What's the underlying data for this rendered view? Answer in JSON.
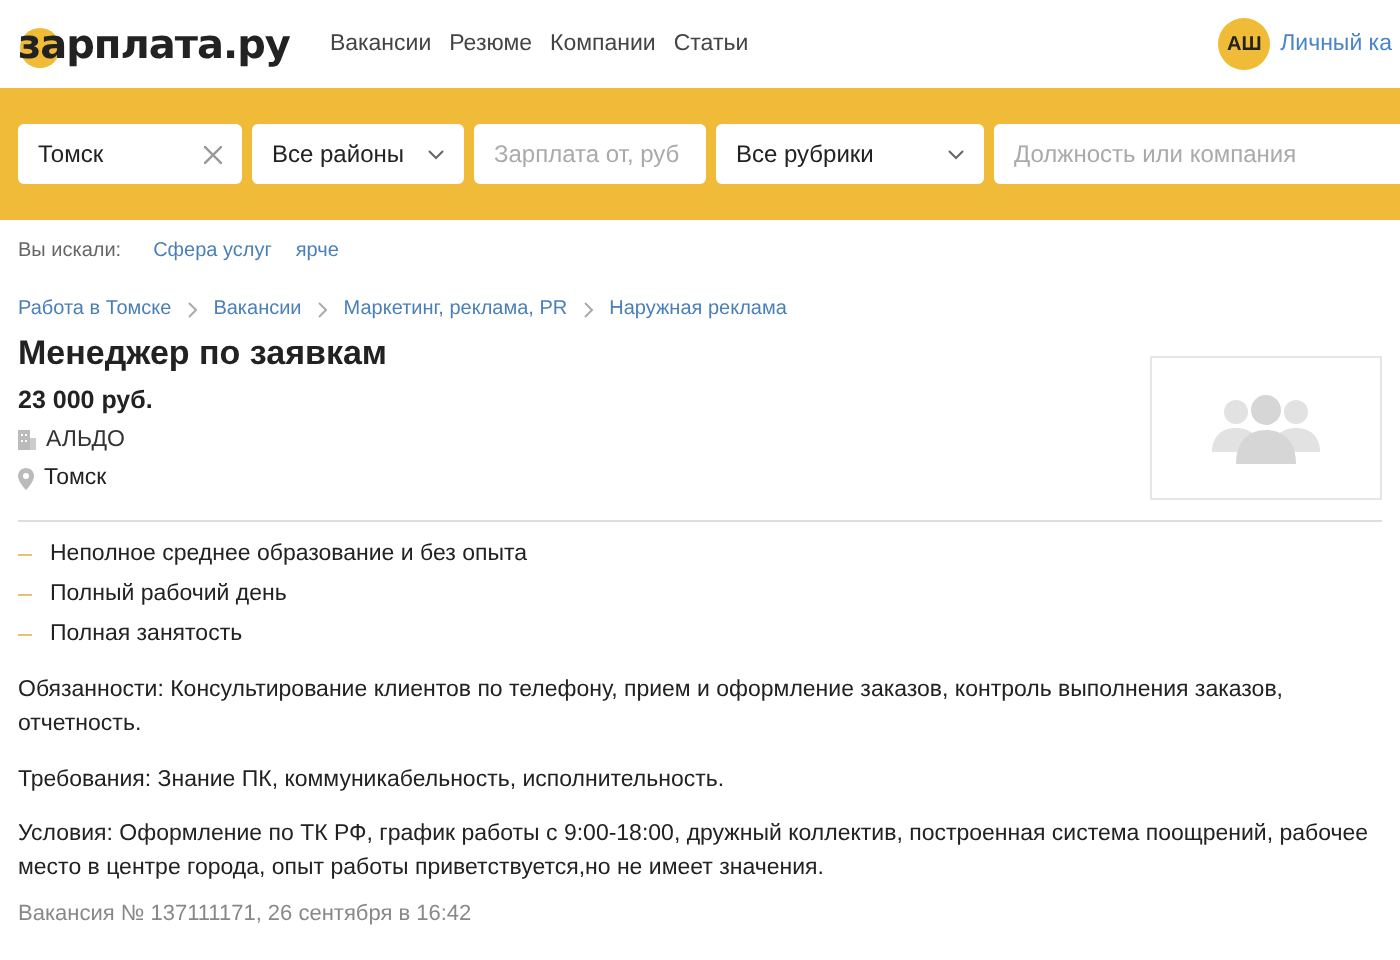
{
  "header": {
    "logo": "зарплата.ру",
    "nav": [
      "Вакансии",
      "Резюме",
      "Компании",
      "Статьи"
    ],
    "avatar": "АШ",
    "account_link": "Личный ка"
  },
  "search": {
    "fields": [
      {
        "kind": "input",
        "value": "Томск",
        "clearable": true
      },
      {
        "kind": "select",
        "value": "Все районы"
      },
      {
        "kind": "input",
        "placeholder": "Зарплата от, руб"
      },
      {
        "kind": "select",
        "value": "Все рубрики"
      },
      {
        "kind": "input",
        "placeholder": "Должность или компания"
      }
    ],
    "history_label": "Вы искали:",
    "history": [
      "Сфера услуг",
      "ярче"
    ]
  },
  "breadcrumbs": [
    "Работа в Томске",
    "Вакансии",
    "Маркетинг, реклама, PR",
    "Наружная реклама"
  ],
  "vacancy": {
    "title": "Менеджер по заявкам",
    "salary": "23 000 руб.",
    "company": "АЛЬДО",
    "city": "Томск",
    "features": [
      "Неполное среднее образование и без опыта",
      "Полный рабочий день",
      "Полная занятость"
    ],
    "paragraphs": [
      "Обязанности: Консультирование клиентов по телефону, прием и оформление заказов, контроль выполнения заказов, отчетность.",
      "Требования: Знание ПК, коммуникабельность, исполнительность.",
      "Условия: Оформление по ТК РФ, график работы с 9:00-18:00, дружный коллектив, построенная система поощрений, рабочее место в центре города, опыт работы приветствуется,но не имеет значения."
    ],
    "meta": "Вакансия № 137111171, 26 сентября в 16:42"
  }
}
